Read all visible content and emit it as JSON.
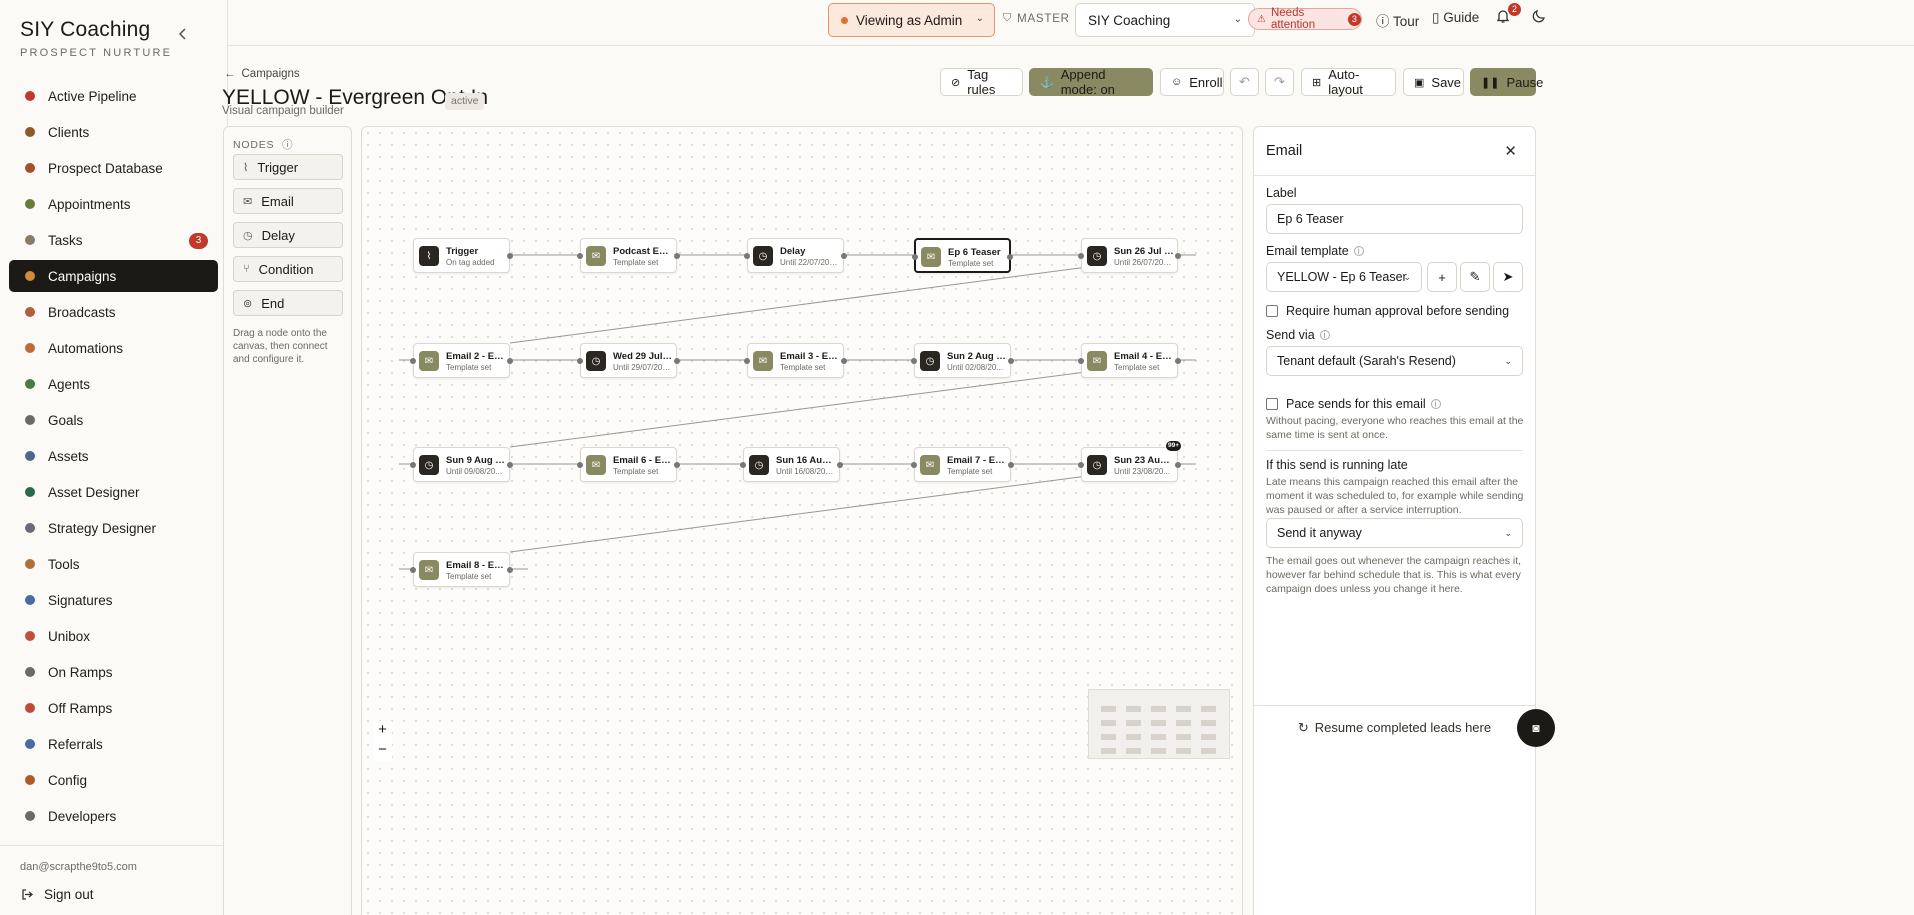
{
  "app": {
    "title": "SIY Coaching",
    "subtitle": "PROSPECT NURTURE"
  },
  "sidebar": {
    "items": [
      {
        "label": "Active Pipeline",
        "icon": "pipeline-icon",
        "color": "#c0392b"
      },
      {
        "label": "Clients",
        "icon": "user-icon",
        "color": "#8a5a2b"
      },
      {
        "label": "Prospect Database",
        "icon": "database-icon",
        "color": "#a0522d"
      },
      {
        "label": "Appointments",
        "icon": "calendar-icon",
        "color": "#6a7a3a"
      },
      {
        "label": "Tasks",
        "icon": "tasks-icon",
        "color": "#8a7a6a",
        "badge": "3"
      },
      {
        "label": "Campaigns",
        "icon": "campaigns-icon",
        "color": "#d08a3a",
        "active": true
      },
      {
        "label": "Broadcasts",
        "icon": "broadcast-icon",
        "color": "#b0603a"
      },
      {
        "label": "Automations",
        "icon": "automation-icon",
        "color": "#c06a3a"
      },
      {
        "label": "Agents",
        "icon": "agent-icon",
        "color": "#4a7a4a"
      },
      {
        "label": "Goals",
        "icon": "goal-icon",
        "color": "#6a6a6a"
      },
      {
        "label": "Assets",
        "icon": "image-icon",
        "color": "#4a6a8a"
      },
      {
        "label": "Asset Designer",
        "icon": "palette-icon",
        "color": "#2a6a4a"
      },
      {
        "label": "Strategy Designer",
        "icon": "strategy-icon",
        "color": "#6a6a7a"
      },
      {
        "label": "Tools",
        "icon": "wrench-icon",
        "color": "#b0703a"
      },
      {
        "label": "Signatures",
        "icon": "pen-icon",
        "color": "#4a6aa0"
      },
      {
        "label": "Unibox",
        "icon": "inbox-icon",
        "color": "#c0503a"
      },
      {
        "label": "On Ramps",
        "icon": "onramp-icon",
        "color": "#6a6a6a"
      },
      {
        "label": "Off Ramps",
        "icon": "offramp-icon",
        "color": "#c04a3a"
      },
      {
        "label": "Referrals",
        "icon": "referral-icon",
        "color": "#4a6aa0"
      },
      {
        "label": "Config",
        "icon": "config-icon",
        "color": "#b05a2a"
      },
      {
        "label": "Developers",
        "icon": "code-icon",
        "color": "#6a6a6a"
      }
    ],
    "user_email": "dan@scrapthe9to5.com",
    "signout": "Sign out"
  },
  "topbar": {
    "viewing": "Viewing as Admin",
    "master": "MASTER",
    "tenant": "SIY Coaching",
    "attention": "Needs attention",
    "attention_count": "3",
    "tour": "Tour",
    "guide": "Guide",
    "notifications": "2"
  },
  "header": {
    "breadcrumb": "Campaigns",
    "title": "YELLOW - Evergreen Opt In",
    "status": "active",
    "subtitle": "Visual campaign builder"
  },
  "toolbar": {
    "tag_rules": "Tag rules",
    "append_mode": "Append mode: on",
    "enroll": "Enroll",
    "auto_layout": "Auto-layout",
    "save": "Save",
    "pause": "Pause"
  },
  "nodes_panel": {
    "heading": "NODES",
    "items": [
      {
        "label": "Trigger",
        "icon": "trigger-icon",
        "glyph": "⌇"
      },
      {
        "label": "Email",
        "icon": "mail-icon",
        "glyph": "✉"
      },
      {
        "label": "Delay",
        "icon": "clock-icon",
        "glyph": "◷"
      },
      {
        "label": "Condition",
        "icon": "branch-icon",
        "glyph": "⑂"
      },
      {
        "label": "End",
        "icon": "end-icon",
        "glyph": "⊚"
      }
    ],
    "help": "Drag a node onto the canvas, then connect and configure it."
  },
  "canvas": {
    "nodes": [
      {
        "title": "Trigger",
        "sub": "On tag added",
        "kind": "trigger"
      },
      {
        "title": "Podcast Epi...",
        "sub": "Template set",
        "kind": "email"
      },
      {
        "title": "Delay",
        "sub": "Until 22/07/202...",
        "kind": "delay"
      },
      {
        "title": "Ep 6 Teaser",
        "sub": "Template set",
        "kind": "email",
        "selected": true
      },
      {
        "title": "Sun 26 Jul 1...",
        "sub": "Until 26/07/202...",
        "kind": "delay"
      },
      {
        "title": "Email 2 - Epi...",
        "sub": "Template set",
        "kind": "email"
      },
      {
        "title": "Wed 29 Jul 1...",
        "sub": "Until 29/07/202...",
        "kind": "delay"
      },
      {
        "title": "Email 3 - Ep ...",
        "sub": "Template set",
        "kind": "email"
      },
      {
        "title": "Sun 2 Aug 1...",
        "sub": "Until 02/08/20...",
        "kind": "delay"
      },
      {
        "title": "Email 4 - Epi...",
        "sub": "Template set",
        "kind": "email"
      },
      {
        "title": "Sun 9 Aug 1...",
        "sub": "Until 09/08/20...",
        "kind": "delay"
      },
      {
        "title": "Email 6 - Epi...",
        "sub": "Template set",
        "kind": "email"
      },
      {
        "title": "Sun 16 Aug 1...",
        "sub": "Until 16/08/202...",
        "kind": "delay"
      },
      {
        "title": "Email 7 - Epi...",
        "sub": "Template set",
        "kind": "email"
      },
      {
        "title": "Sun 23 Aug ...",
        "sub": "Until 23/08/20...",
        "kind": "delay",
        "bubble": "99+"
      },
      {
        "title": "Email 8 - Epi...",
        "sub": "Template set",
        "kind": "email"
      }
    ],
    "zoom_in": "+",
    "zoom_out": "−"
  },
  "panel": {
    "title": "Email",
    "label_caption": "Label",
    "label_value": "Ep 6 Teaser",
    "template_caption": "Email template",
    "template_value": "YELLOW - Ep 6 Teaser",
    "approval": "Require human approval before sending",
    "send_via_caption": "Send via",
    "send_via_value": "Tenant default (Sarah's Resend)",
    "pace": "Pace sends for this email",
    "pace_help": "Without pacing, everyone who reaches this email at the same time is sent at once.",
    "late_heading": "If this send is running late",
    "late_help": "Late means this campaign reached this email after the moment it was scheduled to, for example while sending was paused or after a service interruption.",
    "late_value": "Send it anyway",
    "late_note": "The email goes out whenever the campaign reaches it, however far behind schedule that is. This is what every campaign does unless you change it here.",
    "resume": "Resume completed leads here"
  }
}
